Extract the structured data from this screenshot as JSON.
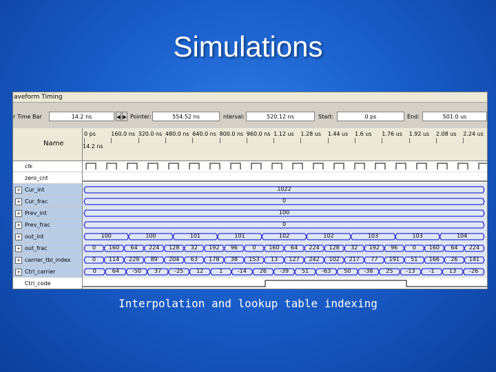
{
  "slide": {
    "title": "Simulations",
    "caption": "Interpolation and lookup table indexing"
  },
  "window": {
    "title": "aveform Timing"
  },
  "toolbar": {
    "master_time_bar_label": "r Time Bar",
    "master_time_bar_value": "14.2 ns",
    "pointer_label": "Pointer:",
    "pointer_value": "554.52 ns",
    "interval_label": "nterval:",
    "interval_value": "520.12 ns",
    "start_label": "Start:",
    "start_value": "0 ps",
    "end_label": "End:",
    "end_value": "501.0 us"
  },
  "timeline": {
    "name_header": "Name",
    "cursor_time": "14.2 ns",
    "ticks": [
      "0 ps",
      "160.0 ns",
      "320.0 ns",
      "480.0 ns",
      "640.0 ns",
      "800.0 ns",
      "960.0 ns",
      "1.12 us",
      "1.28 us",
      "1.44 us",
      "1.6 us",
      "1.76 us",
      "1.92 us",
      "2.08 us",
      "2.24 us"
    ]
  },
  "signals": [
    {
      "name": "clk",
      "kind": "clock"
    },
    {
      "name": "zero_cnt",
      "kind": "low"
    },
    {
      "name": "Cur_int",
      "kind": "bus",
      "segments": [
        "1022"
      ]
    },
    {
      "name": "Cur_frac",
      "kind": "bus",
      "segments": [
        "0"
      ]
    },
    {
      "name": "Prev_int",
      "kind": "bus",
      "segments": [
        "100"
      ]
    },
    {
      "name": "Prev_frac",
      "kind": "bus",
      "segments": [
        "0"
      ]
    },
    {
      "name": "out_int",
      "kind": "bus",
      "segments": [
        "100",
        "100",
        "101",
        "101",
        "102",
        "102",
        "103",
        "103",
        "104"
      ]
    },
    {
      "name": "out_frac",
      "kind": "bus",
      "segments": [
        "0",
        "160",
        "64",
        "224",
        "128",
        "32",
        "192",
        "96",
        "0",
        "160",
        "64",
        "224",
        "128",
        "32",
        "192",
        "96",
        "0",
        "160",
        "64",
        "224"
      ]
    },
    {
      "name": "carrier_tbl_index",
      "kind": "bus",
      "segments": [
        "0",
        "114",
        "229",
        "89",
        "204",
        "63",
        "178",
        "38",
        "153",
        "13",
        "127",
        "242",
        "102",
        "217",
        "77",
        "191",
        "51",
        "166",
        "26",
        "141"
      ]
    },
    {
      "name": "Ctrl_carrier",
      "kind": "bus",
      "segments": [
        "0",
        "64",
        "-50",
        "37",
        "-25",
        "12",
        "1",
        "-14",
        "26",
        "-39",
        "51",
        "-63",
        "50",
        "-38",
        "25",
        "-13",
        "-1",
        "13",
        "-26"
      ]
    },
    {
      "name": "Ctrl_code",
      "kind": "pulse"
    }
  ],
  "colors": {
    "wave": "#0000cc",
    "bus_fill": "#dfe8f5",
    "row_highlight": "#b9cde6"
  }
}
